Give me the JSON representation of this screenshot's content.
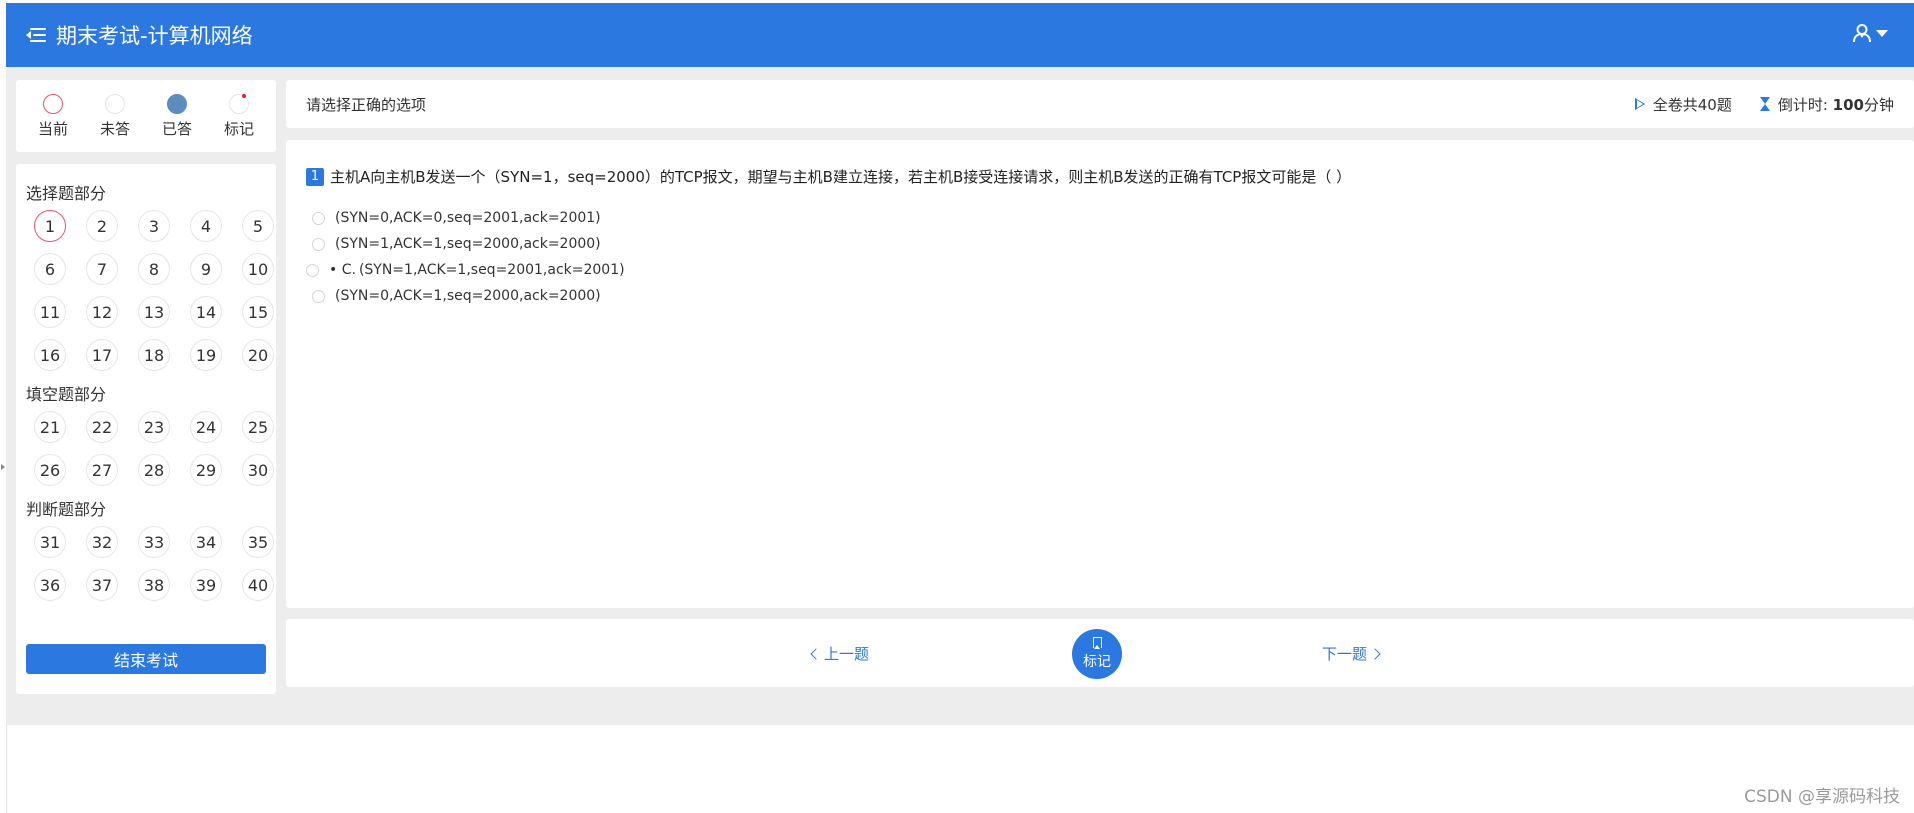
{
  "app": {
    "title": "期末考试-计算机网络"
  },
  "legend": [
    {
      "label": "当前",
      "state": "current"
    },
    {
      "label": "未答",
      "state": "unanswered"
    },
    {
      "label": "已答",
      "state": "answered"
    },
    {
      "label": "标记",
      "state": "marked"
    }
  ],
  "sections": [
    {
      "title": "选择题部分",
      "numbers": [
        "1",
        "2",
        "3",
        "4",
        "5",
        "6",
        "7",
        "8",
        "9",
        "10",
        "11",
        "12",
        "13",
        "14",
        "15",
        "16",
        "17",
        "18",
        "19",
        "20"
      ]
    },
    {
      "title": "填空题部分",
      "numbers": [
        "21",
        "22",
        "23",
        "24",
        "25",
        "26",
        "27",
        "28",
        "29",
        "30"
      ]
    },
    {
      "title": "判断题部分",
      "numbers": [
        "31",
        "32",
        "33",
        "34",
        "35",
        "36",
        "37",
        "38",
        "39",
        "40"
      ]
    }
  ],
  "current_question": "1",
  "end_button": "结束考试",
  "header": {
    "instruction": "请选择正确的选项",
    "total": "全卷共40题",
    "timer_label": "倒计时:",
    "timer_value": "100",
    "timer_unit": "分钟"
  },
  "question": {
    "number": "1",
    "text": "主机A向主机B发送一个（SYN=1，seq=2000）的TCP报文，期望与主机B建立连接，若主机B接受连接请求，则主机B发送的正确有TCP报文可能是（ ）",
    "options": [
      {
        "prefix": "",
        "text": "(SYN=0,ACK=0,seq=2001,ack=2001)"
      },
      {
        "prefix": "",
        "text": "(SYN=1,ACK=1,seq=2000,ack=2000)"
      },
      {
        "prefix": "• C.",
        "text": "(SYN=1,ACK=1,seq=2001,ack=2001)"
      },
      {
        "prefix": "",
        "text": "(SYN=0,ACK=1,seq=2000,ack=2000)"
      }
    ]
  },
  "nav": {
    "prev": "上一题",
    "mark": "标记",
    "next": "下一题"
  },
  "watermark": "CSDN @享源码科技",
  "colors": {
    "primary": "#2b78e0",
    "current_border": "#e05a72",
    "answered": "#5d8cc0",
    "mark_dot": "#e0202c"
  }
}
